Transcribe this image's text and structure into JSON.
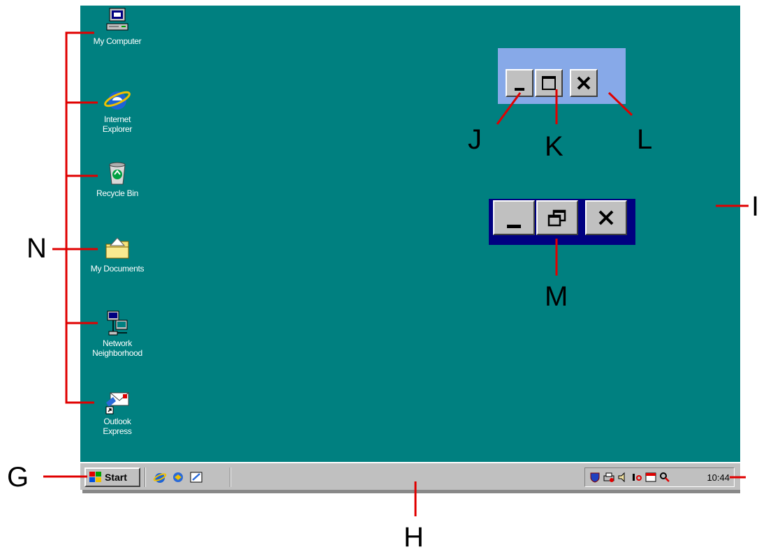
{
  "desktop": {
    "background": "#008080",
    "icons": [
      {
        "name": "My Computer",
        "icon": "computer-icon"
      },
      {
        "name": "Internet\nExplorer",
        "icon": "internet-explorer-icon"
      },
      {
        "name": "Recycle Bin",
        "icon": "recycle-bin-icon"
      },
      {
        "name": "My Documents",
        "icon": "folder-icon"
      },
      {
        "name": "Network\nNeighborhood",
        "icon": "network-icon"
      },
      {
        "name": "Outlook\nExpress",
        "icon": "outlook-express-icon"
      }
    ]
  },
  "taskbar": {
    "start_label": "Start",
    "quick_launch": [
      "internet-explorer-icon",
      "outlook-icon",
      "show-desktop-icon"
    ],
    "tray_icons": [
      "shield-icon",
      "printer-icon",
      "speaker-icon",
      "network-icon",
      "calendar-icon",
      "search-icon"
    ],
    "clock": "10:44"
  },
  "window_buttons": {
    "top_group": [
      "minimize-button",
      "maximize-button",
      "close-button"
    ],
    "bottom_group": [
      "minimize-button",
      "restore-button",
      "close-button"
    ]
  },
  "callouts": {
    "G": "G",
    "H": "H",
    "I": "I",
    "J": "J",
    "K": "K",
    "L": "L",
    "M": "M",
    "N": "N"
  },
  "colors": {
    "accent_red": "#e00000",
    "title_active": "#000080",
    "title_light": "#87a9e8",
    "face": "#c0c0c0"
  }
}
